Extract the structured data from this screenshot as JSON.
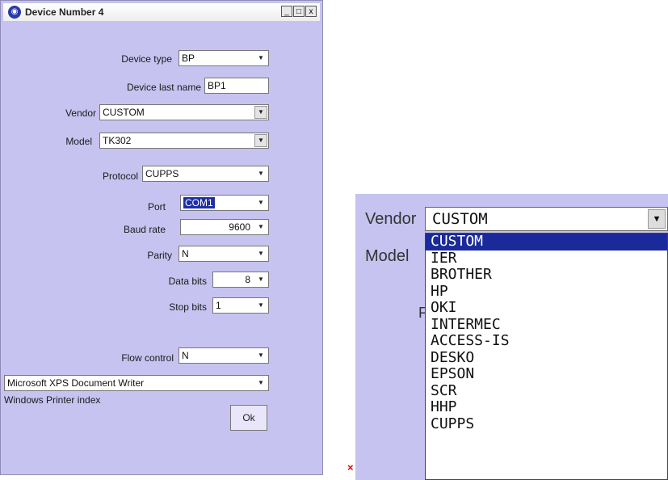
{
  "window": {
    "title": "Device Number 4",
    "btn_min": "_",
    "btn_max": "□",
    "btn_close": "x"
  },
  "form": {
    "device_type": {
      "label": "Device type",
      "value": "BP"
    },
    "device_last_name": {
      "label": "Device last name",
      "value": "BP1"
    },
    "vendor": {
      "label": "Vendor",
      "value": "CUSTOM"
    },
    "model": {
      "label": "Model",
      "value": "TK302"
    },
    "protocol": {
      "label": "Protocol",
      "value": "CUPPS"
    },
    "port": {
      "label": "Port",
      "value": "COM1"
    },
    "baud_rate": {
      "label": "Baud rate",
      "value": "9600"
    },
    "parity": {
      "label": "Parity",
      "value": "N"
    },
    "data_bits": {
      "label": "Data bits",
      "value": "8"
    },
    "stop_bits": {
      "label": "Stop bits",
      "value": "1"
    },
    "flow_control": {
      "label": "Flow control",
      "value": "N"
    },
    "printer": {
      "value": "Microsoft XPS Document Writer"
    },
    "printer_index_label": "Windows Printer index",
    "ok_label": "Ok"
  },
  "close_marker": "×",
  "zoom": {
    "vendor_label": "Vendor",
    "model_label": "Model",
    "partial_label": "F",
    "vendor_value": "CUSTOM",
    "vendor_options": [
      "CUSTOM",
      "IER",
      "BROTHER",
      "HP",
      "OKI",
      "INTERMEC",
      "ACCESS-IS",
      "DESKO",
      "EPSON",
      "SCR",
      "HHP",
      "CUPPS"
    ],
    "selected_option": "CUSTOM"
  },
  "icons": {
    "dropdown": "▼",
    "window_logo": "globe-icon"
  },
  "colors": {
    "window_bg": "#c6c3f0",
    "highlight": "#1f2fa8"
  }
}
